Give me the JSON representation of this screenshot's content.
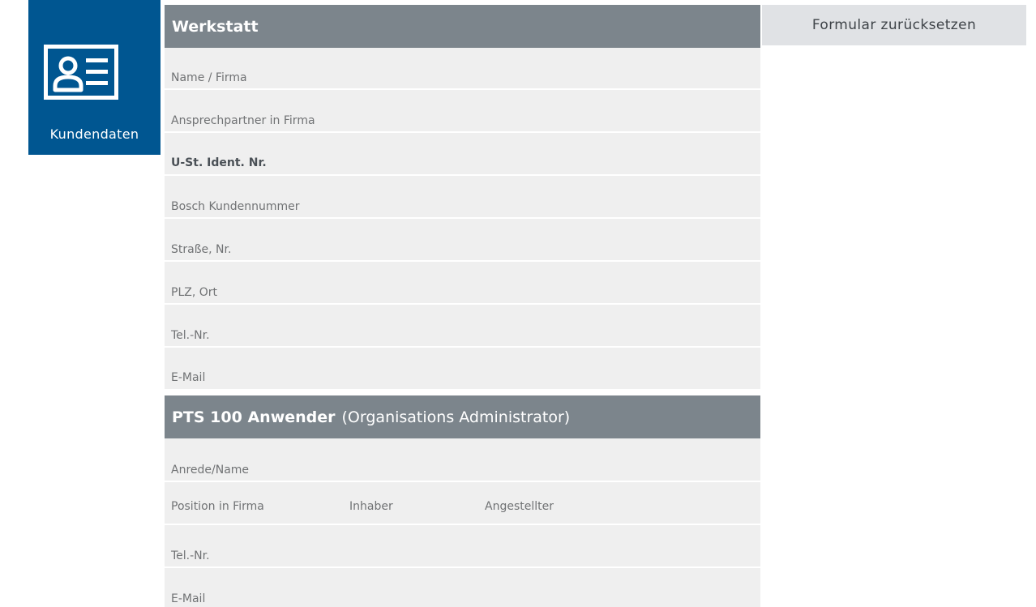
{
  "badge": {
    "label": "Kundendaten",
    "icon": "contact-card-icon"
  },
  "reset_button": {
    "label": "Formular zurücksetzen"
  },
  "section_werkstatt": {
    "title": "Werkstatt",
    "fields": [
      "Name / Firma",
      "Ansprechpartner in Firma",
      "U-St. Ident. Nr.",
      "Bosch Kundennummer",
      "Straße, Nr.",
      "PLZ, Ort",
      "Tel.-Nr.",
      "E-Mail"
    ]
  },
  "section_anwender": {
    "title_bold": "PTS 100 Anwender",
    "title_rest": "(Organisations Administrator)",
    "fields": {
      "anrede": "Anrede/Name",
      "position": "Position in Firma",
      "position_options": [
        "Inhaber",
        "Angestellter"
      ],
      "tel": "Tel.-Nr.",
      "email": "E-Mail"
    }
  },
  "colors": {
    "brand_blue": "#005691",
    "header_gray": "#7c858c",
    "field_bg": "#efefef",
    "button_bg": "#e0e2e5"
  }
}
